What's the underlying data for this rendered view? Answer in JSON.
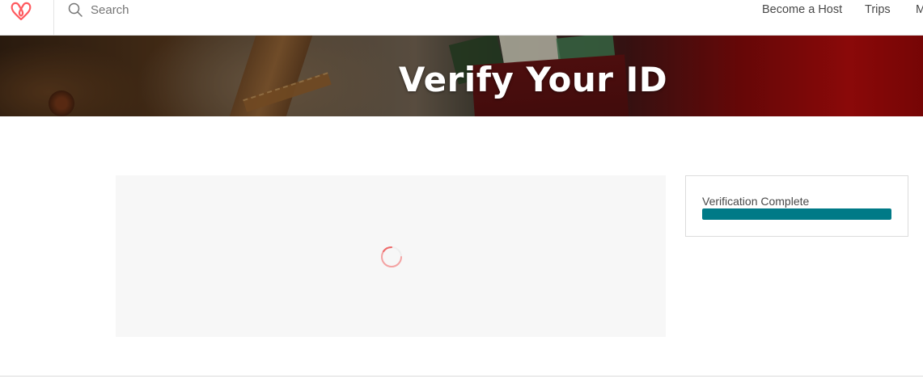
{
  "nav": {
    "logo": "airbnb-logo",
    "search": {
      "placeholder": "Search",
      "value": ""
    },
    "links": [
      {
        "label": "Become a Host"
      },
      {
        "label": "Trips"
      },
      {
        "label": "M"
      }
    ]
  },
  "hero": {
    "title": "Verify Your ID"
  },
  "status": {
    "label": "Verification Complete",
    "progress": 1.0
  },
  "colors": {
    "brand": "#ff5a5f",
    "progress": "#007a87",
    "text": "#484848"
  }
}
